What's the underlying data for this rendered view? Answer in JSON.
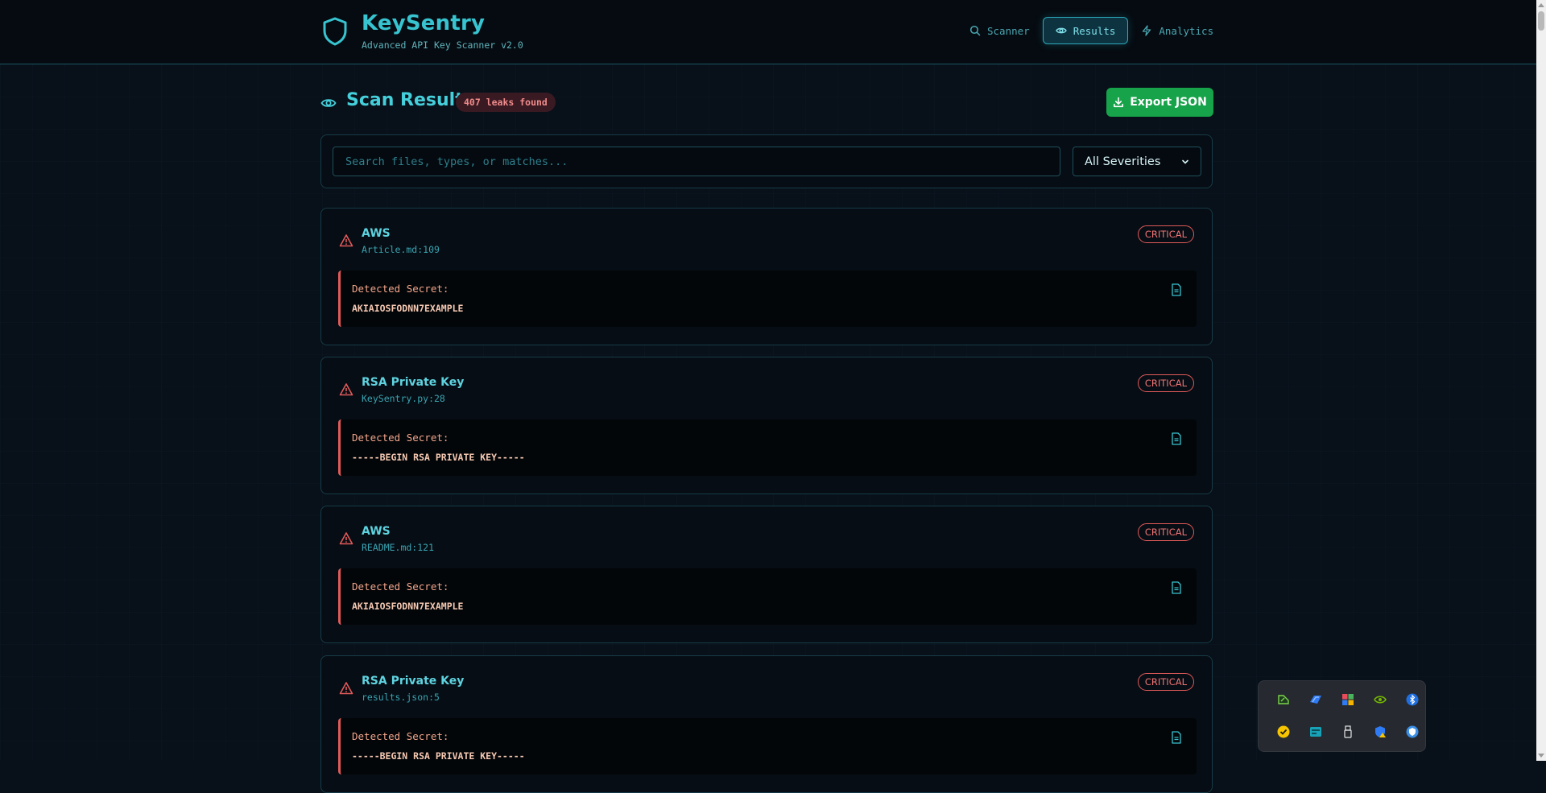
{
  "header": {
    "title": "KeySentry",
    "subtitle": "Advanced API Key Scanner v2.0",
    "nav": [
      {
        "label": "Scanner",
        "icon": "search-icon",
        "active": false
      },
      {
        "label": "Results",
        "icon": "eye-icon",
        "active": true
      },
      {
        "label": "Analytics",
        "icon": "bolt-icon",
        "active": false
      }
    ]
  },
  "page": {
    "title": "Scan Results",
    "badge": "407 leaks found",
    "export_label": "Export JSON"
  },
  "filters": {
    "search_placeholder": "Search files, types, or matches...",
    "search_value": "",
    "severity_selected": "All Severities"
  },
  "results": [
    {
      "type": "AWS",
      "file": "Article.md:109",
      "severity": "CRITICAL",
      "secret_label": "Detected Secret:",
      "secret": "AKIAIOSFODNN7EXAMPLE"
    },
    {
      "type": "RSA Private Key",
      "file": "KeySentry.py:28",
      "severity": "CRITICAL",
      "secret_label": "Detected Secret:",
      "secret": "-----BEGIN RSA PRIVATE KEY-----"
    },
    {
      "type": "AWS",
      "file": "README.md:121",
      "severity": "CRITICAL",
      "secret_label": "Detected Secret:",
      "secret": "AKIAIOSFODNN7EXAMPLE"
    },
    {
      "type": "RSA Private Key",
      "file": "results.json:5",
      "severity": "CRITICAL",
      "secret_label": "Detected Secret:",
      "secret": "-----BEGIN RSA PRIVATE KEY-----"
    }
  ],
  "colors": {
    "accent": "#37c4d0",
    "critical": "#e05a5a",
    "export": "#16a34a",
    "background": "#081019"
  },
  "tray_icons": [
    "dev-tool-icon",
    "azure-devops-icon",
    "color-app-icon",
    "nvidia-icon",
    "bluetooth-icon",
    "norton-icon",
    "display-app-icon",
    "usb-eject-icon",
    "security-warning-icon",
    "security-app-icon"
  ]
}
